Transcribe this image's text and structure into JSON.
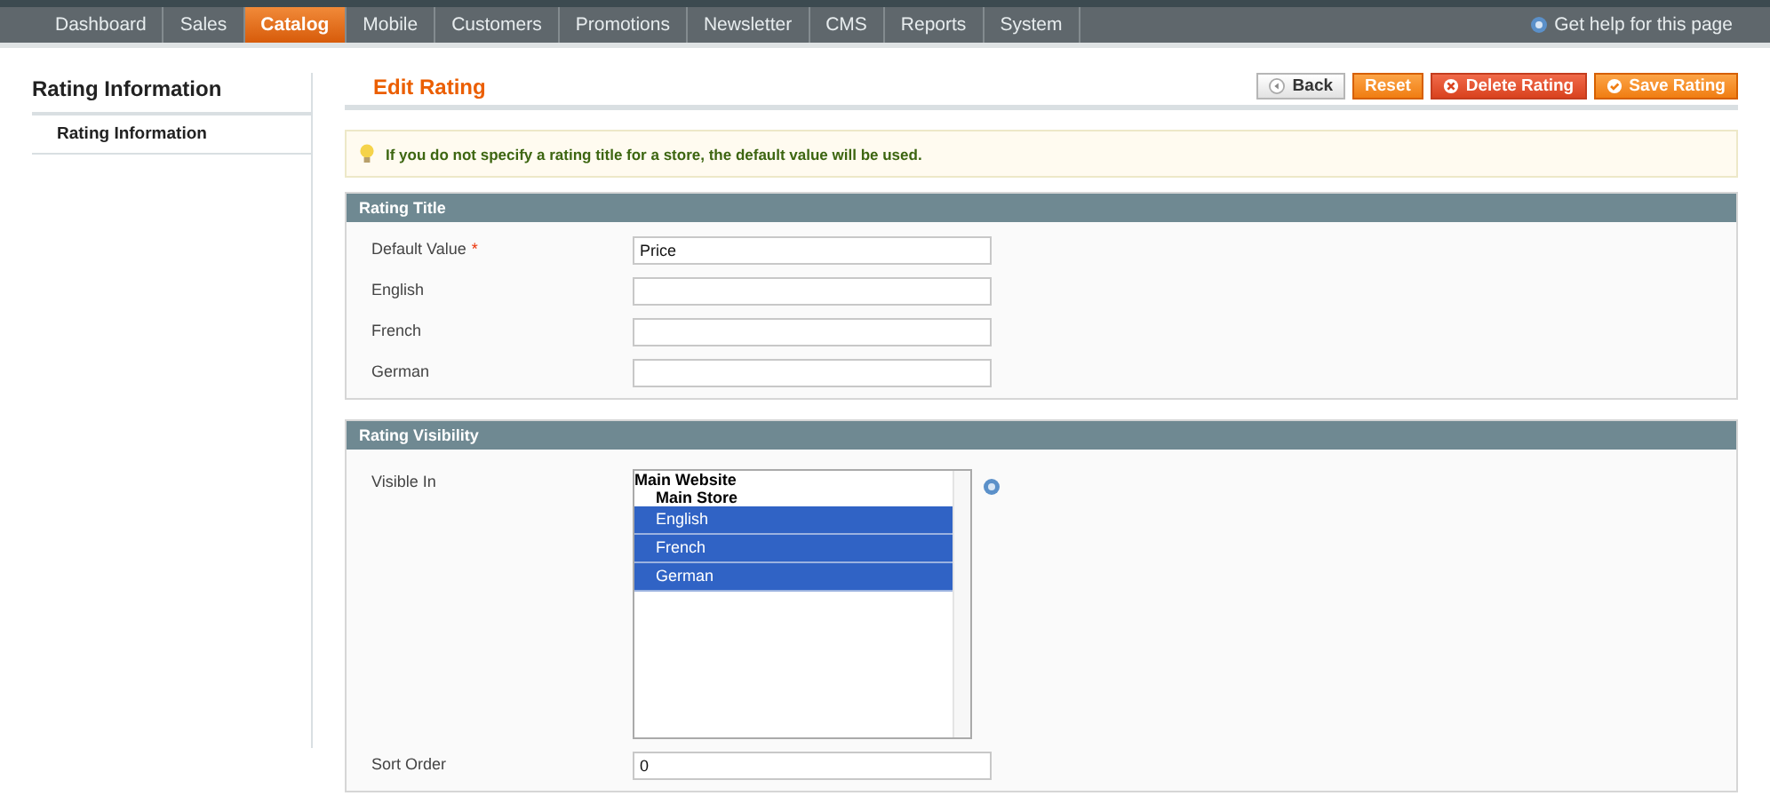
{
  "nav": {
    "items": [
      {
        "label": "Dashboard",
        "selected": false
      },
      {
        "label": "Sales",
        "selected": false
      },
      {
        "label": "Catalog",
        "selected": true
      },
      {
        "label": "Mobile",
        "selected": false
      },
      {
        "label": "Customers",
        "selected": false
      },
      {
        "label": "Promotions",
        "selected": false
      },
      {
        "label": "Newsletter",
        "selected": false
      },
      {
        "label": "CMS",
        "selected": false
      },
      {
        "label": "Reports",
        "selected": false
      },
      {
        "label": "System",
        "selected": false
      }
    ],
    "help": "Get help for this page"
  },
  "sidebar": {
    "title": "Rating Information",
    "items": [
      {
        "label": "Rating Information",
        "selected": true
      }
    ]
  },
  "page": {
    "title": "Edit Rating",
    "buttons": [
      {
        "label": "Back",
        "kind": "back"
      },
      {
        "label": "Reset",
        "kind": "plain"
      },
      {
        "label": "Delete Rating",
        "kind": "delete"
      },
      {
        "label": "Save Rating",
        "kind": "save"
      }
    ],
    "notice": "If you do not specify a rating title for a store, the default value will be used."
  },
  "rating_title": {
    "heading": "Rating Title",
    "fields": [
      {
        "label": "Default Value",
        "required_mark": "*",
        "value": "Price"
      },
      {
        "label": "English"
      },
      {
        "label": "French"
      },
      {
        "label": "German"
      }
    ]
  },
  "rating_visibility": {
    "heading": "Rating Visibility",
    "visible_in": {
      "label": "Visible In",
      "options": [
        {
          "label": "Main Website",
          "kind": "website",
          "selected": false
        },
        {
          "label": "Main Store",
          "kind": "store",
          "selected": false
        },
        {
          "label": "English",
          "kind": "view",
          "selected": true
        },
        {
          "label": "French",
          "kind": "view",
          "selected": true
        },
        {
          "label": "German",
          "kind": "view",
          "selected": true
        }
      ]
    },
    "sort_order": {
      "label": "Sort Order",
      "value": "0"
    }
  }
}
